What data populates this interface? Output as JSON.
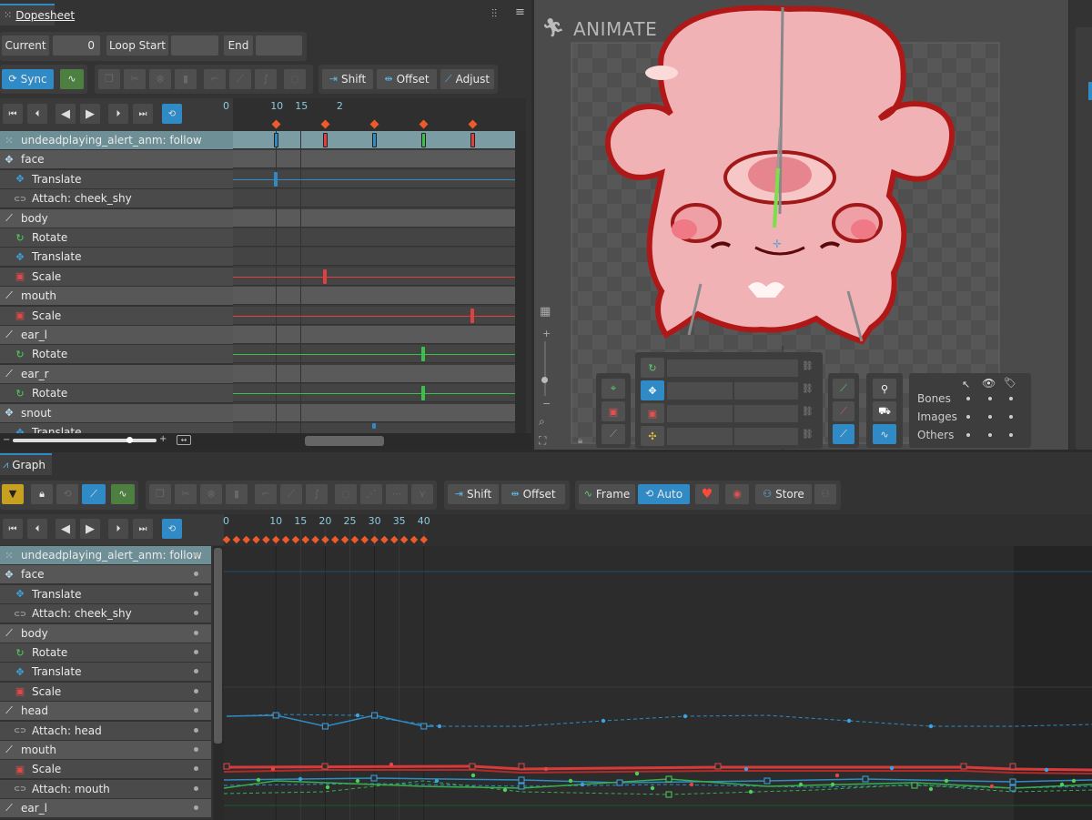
{
  "dopesheet": {
    "tab_label": "Dopesheet",
    "current_label": "Current",
    "current_value": "0",
    "loop_start_label": "Loop Start",
    "end_label": "End",
    "sync_label": "Sync",
    "shift_label": "Shift",
    "offset_label": "Offset",
    "adjust_label": "Adjust",
    "ruler_ticks": [
      "0",
      "10",
      "15",
      "2"
    ],
    "rows": [
      {
        "label": "undeadplaying_alert_anm: follow",
        "kind": "hdr",
        "icon": "animation-icon"
      },
      {
        "label": "face",
        "kind": "sec",
        "icon": "bone-move-icon"
      },
      {
        "label": "Translate",
        "kind": "sub",
        "icon": "translate-icon"
      },
      {
        "label": "Attach: cheek_shy",
        "kind": "sub",
        "icon": "attachment-icon"
      },
      {
        "label": "body",
        "kind": "sec",
        "icon": "bone-icon"
      },
      {
        "label": "Rotate",
        "kind": "sub",
        "icon": "rotate-icon"
      },
      {
        "label": "Translate",
        "kind": "sub",
        "icon": "translate-icon"
      },
      {
        "label": "Scale",
        "kind": "sub",
        "icon": "scale-icon"
      },
      {
        "label": "mouth",
        "kind": "sec",
        "icon": "bone-icon"
      },
      {
        "label": "Scale",
        "kind": "sub",
        "icon": "scale-icon"
      },
      {
        "label": "ear_l",
        "kind": "sec",
        "icon": "bone-icon"
      },
      {
        "label": "Rotate",
        "kind": "sub",
        "icon": "rotate-icon"
      },
      {
        "label": "ear_r",
        "kind": "sec",
        "icon": "bone-icon"
      },
      {
        "label": "Rotate",
        "kind": "sub",
        "icon": "rotate-icon"
      },
      {
        "label": "snout",
        "kind": "sec",
        "icon": "bone-move-icon"
      },
      {
        "label": "Translate",
        "kind": "sub",
        "icon": "translate-icon"
      }
    ]
  },
  "viewport": {
    "title": "ANIMATE",
    "legend": {
      "bones": "Bones",
      "images": "Images",
      "others": "Others"
    }
  },
  "graph": {
    "tab_label": "Graph",
    "shift_label": "Shift",
    "offset_label": "Offset",
    "frame_label": "Frame",
    "auto_label": "Auto",
    "store_label": "Store",
    "ruler_ticks": [
      "0",
      "10",
      "15",
      "20",
      "25",
      "30",
      "35",
      "40"
    ],
    "rows": [
      {
        "label": "undeadplaying_alert_anm: follow",
        "kind": "hdr",
        "icon": "animation-icon"
      },
      {
        "label": "face",
        "kind": "sec",
        "icon": "bone-move-icon"
      },
      {
        "label": "Translate",
        "kind": "sub",
        "icon": "translate-icon"
      },
      {
        "label": "Attach: cheek_shy",
        "kind": "sub",
        "icon": "attachment-icon"
      },
      {
        "label": "body",
        "kind": "sec",
        "icon": "bone-icon"
      },
      {
        "label": "Rotate",
        "kind": "sub",
        "icon": "rotate-icon"
      },
      {
        "label": "Translate",
        "kind": "sub",
        "icon": "translate-icon"
      },
      {
        "label": "Scale",
        "kind": "sub",
        "icon": "scale-icon"
      },
      {
        "label": "head",
        "kind": "sec",
        "icon": "bone-icon"
      },
      {
        "label": "Attach: head",
        "kind": "sub",
        "icon": "attachment-icon"
      },
      {
        "label": "mouth",
        "kind": "sec",
        "icon": "bone-icon"
      },
      {
        "label": "Scale",
        "kind": "sub",
        "icon": "scale-icon"
      },
      {
        "label": "Attach: mouth",
        "kind": "sub",
        "icon": "attachment-icon"
      },
      {
        "label": "ear_l",
        "kind": "sec",
        "icon": "bone-icon"
      }
    ]
  },
  "colors": {
    "accent": "#2f8ac5",
    "keyframe": "#ef5a2a",
    "translate": "#2f8ac5",
    "scale": "#e04040",
    "rotate": "#3cc04a",
    "header_row": "#6e8f96"
  }
}
